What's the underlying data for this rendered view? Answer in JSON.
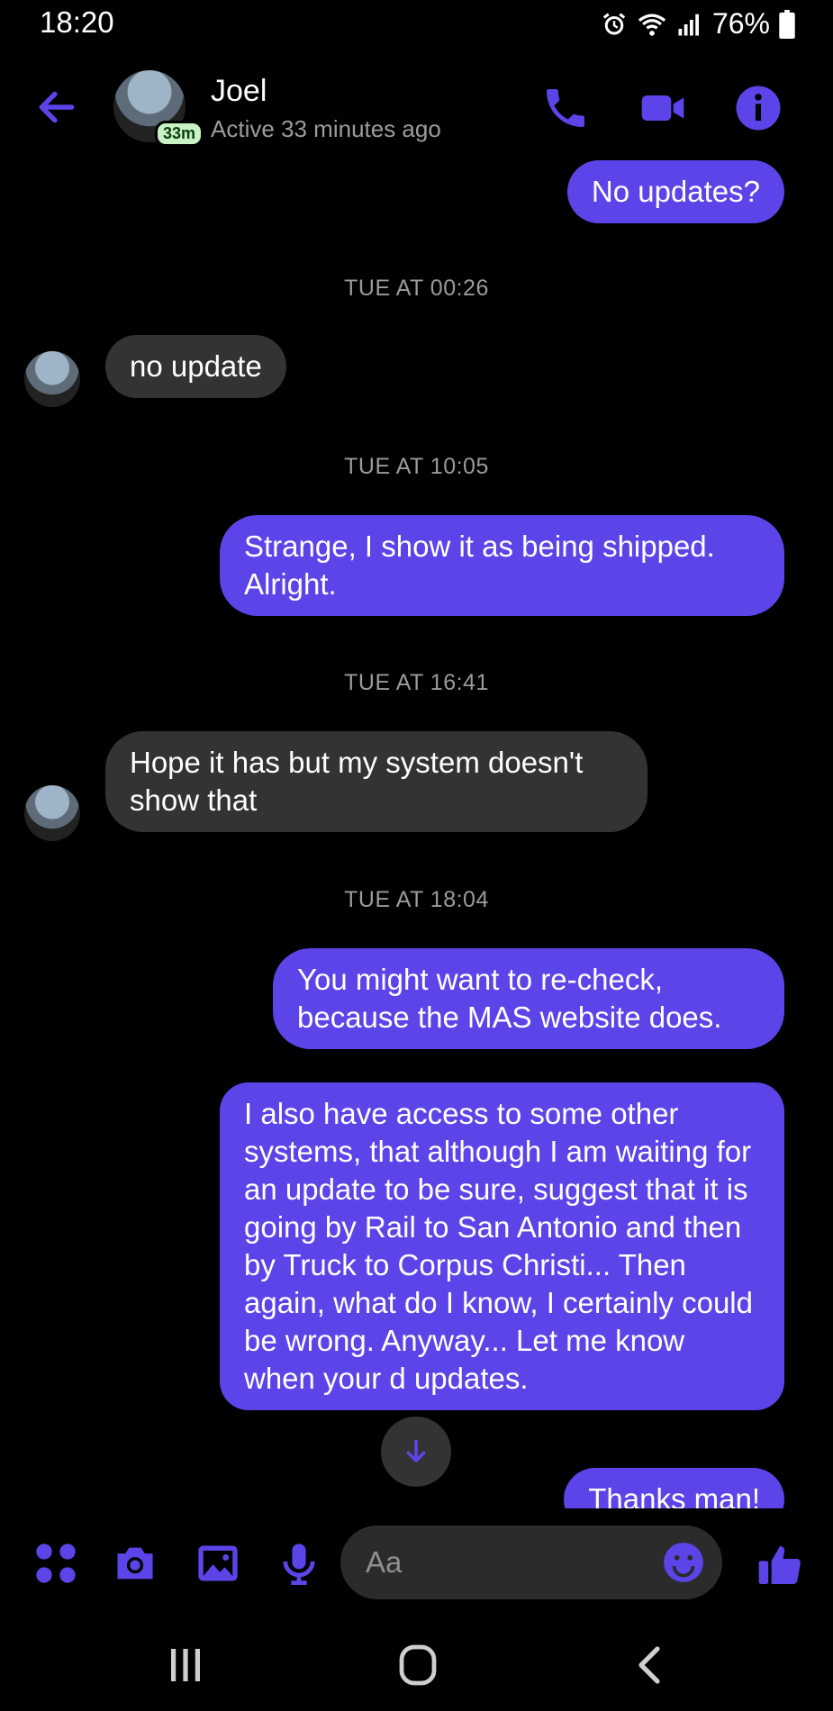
{
  "status_bar": {
    "time": "18:20",
    "battery": "76%"
  },
  "header": {
    "contact_name": "Joel",
    "active_badge": "33m",
    "status": "Active 33 minutes ago"
  },
  "messages": [
    {
      "type": "out",
      "text": "No updates?"
    },
    {
      "type": "timestamp",
      "text": "TUE AT 00:26"
    },
    {
      "type": "in",
      "text": "no update"
    },
    {
      "type": "timestamp",
      "text": "TUE AT 10:05"
    },
    {
      "type": "out",
      "text": "Strange, I show it as being shipped. Alright."
    },
    {
      "type": "timestamp",
      "text": "TUE AT 16:41"
    },
    {
      "type": "in",
      "text": "Hope it has but my system doesn't show that"
    },
    {
      "type": "timestamp",
      "text": "TUE AT 18:04"
    },
    {
      "type": "out",
      "text": "You might want to re-check, because the MAS website does."
    },
    {
      "type": "out",
      "text": "I also have access to some other systems, that although I am waiting for an update to be sure, suggest that it is going by Rail to San Antonio and then by Truck to Corpus Christi... Then again, what do I know, I certainly could be wrong. Anyway... Let me know when your d updates."
    },
    {
      "type": "out",
      "text": "Thanks man!"
    }
  ],
  "composer": {
    "placeholder": "Aa"
  },
  "colors": {
    "accent": "#5b45e8",
    "incoming_bubble": "#333333",
    "background": "#000000"
  },
  "icons": [
    "back-arrow-icon",
    "phone-icon",
    "video-icon",
    "info-icon",
    "apps-icon",
    "camera-icon",
    "gallery-icon",
    "mic-icon",
    "emoji-icon",
    "thumbs-up-icon",
    "chevron-down-icon"
  ]
}
